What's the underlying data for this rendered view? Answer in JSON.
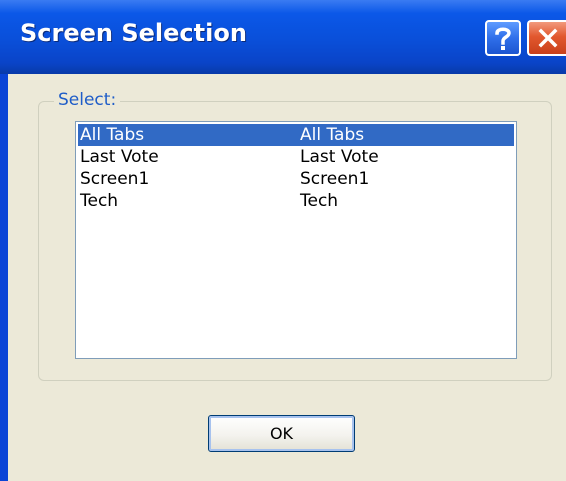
{
  "window": {
    "title": "Screen Selection",
    "help_icon": "help-icon",
    "close_icon": "close-icon"
  },
  "group": {
    "label": "Select:"
  },
  "list": {
    "items": [
      {
        "col1": "All Tabs",
        "col2": "All Tabs",
        "selected": true
      },
      {
        "col1": "Last Vote",
        "col2": "Last Vote",
        "selected": false
      },
      {
        "col1": "Screen1",
        "col2": "Screen1",
        "selected": false
      },
      {
        "col1": "Tech",
        "col2": "Tech",
        "selected": false
      }
    ]
  },
  "buttons": {
    "ok_label": "OK"
  },
  "colors": {
    "titlebar": "#0a4fd9",
    "selection": "#316ac5",
    "dialog_bg": "#ece9d8",
    "group_label": "#1f5dc8"
  }
}
